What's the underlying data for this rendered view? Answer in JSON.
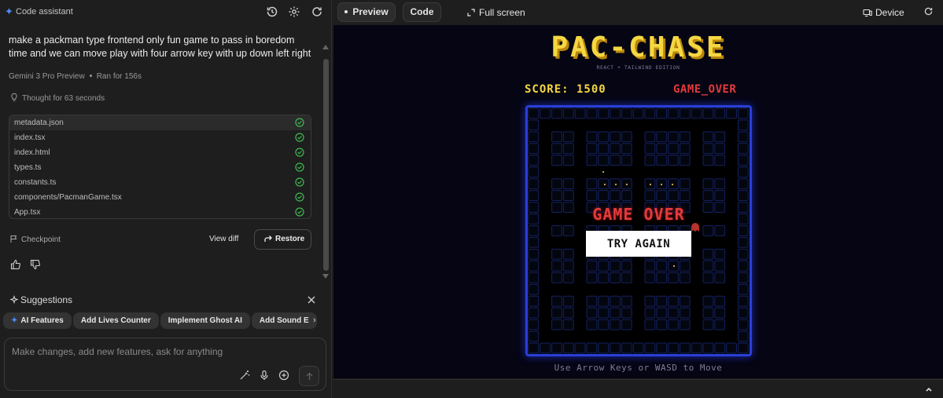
{
  "header": {
    "app_title": "Code assistant"
  },
  "conversation": {
    "prompt": "make a packman type frontend only fun game to pass in boredom time and we can move play with four arrow key with up down left right",
    "model": "Gemini 3 Pro Preview",
    "run_time": "Ran for 156s",
    "thought": "Thought for 63 seconds",
    "files": [
      "metadata.json",
      "index.tsx",
      "index.html",
      "types.ts",
      "constants.ts",
      "components/PacmanGame.tsx",
      "App.tsx"
    ],
    "checkpoint_label": "Checkpoint",
    "view_diff_label": "View diff",
    "restore_label": "Restore"
  },
  "suggestions": {
    "title": "Suggestions",
    "chips": [
      "AI Features",
      "Add Lives Counter",
      "Implement Ghost AI",
      "Add Sound E"
    ]
  },
  "input": {
    "placeholder": "Make changes, add new features, ask for anything"
  },
  "preview_header": {
    "preview_tab": "Preview",
    "code_tab": "Code",
    "fullscreen_label": "Full screen",
    "device_label": "Device"
  },
  "game": {
    "title": "PAC-CHASE",
    "subtitle": "REACT + TAILWIND EDITION",
    "score": "SCORE: 1500",
    "status": "GAME_OVER",
    "overlay_title": "GAME OVER",
    "try_again": "TRY AGAIN",
    "hint": "Use Arrow Keys or WASD to Move"
  },
  "colors": {
    "accent_blue": "#4c8df6",
    "success_green": "#3fb950",
    "title_yellow": "#f5d742",
    "game_over_red": "#e33b3b",
    "maze_blue": "#2a3fd6"
  }
}
